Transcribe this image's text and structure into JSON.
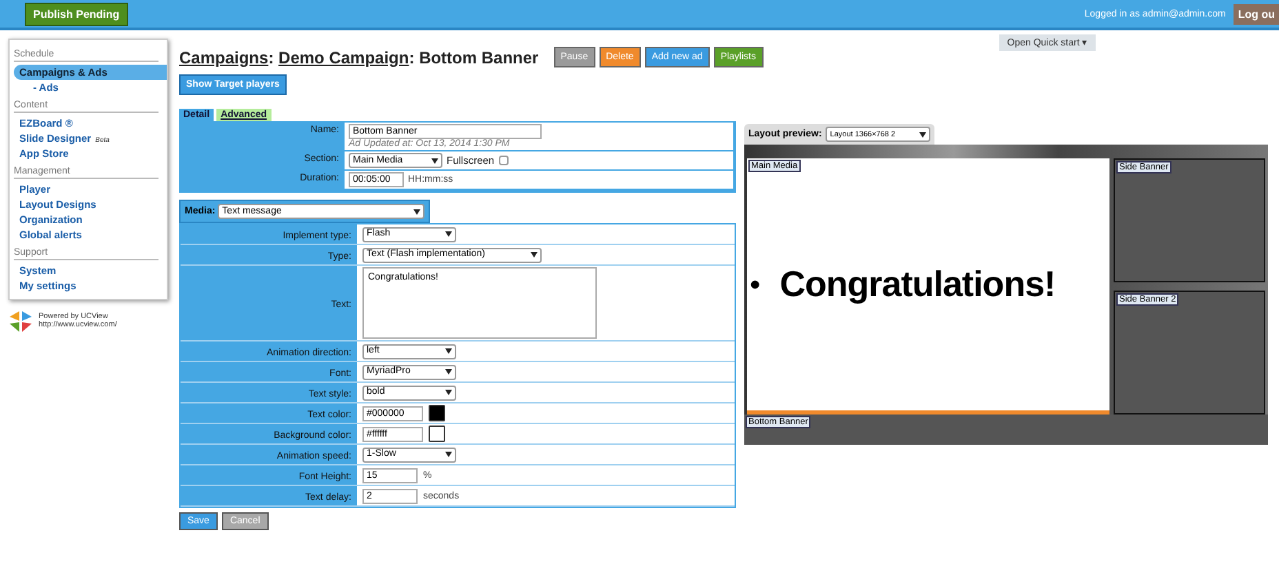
{
  "top_bar": {
    "publish_button": "Publish Pending",
    "logged_in": "Logged in as admin@admin.com",
    "logout_button": "Log ou"
  },
  "quick_start": "Open Quick start ▾",
  "sidebar": {
    "sections": [
      {
        "title": "Schedule",
        "items": [
          {
            "label": "Campaigns & Ads",
            "kind": "item",
            "selected": true
          },
          {
            "label": "- Ads",
            "kind": "sub",
            "selected": false
          }
        ]
      },
      {
        "title": "Content",
        "items": [
          {
            "label": "EZBoard ®",
            "kind": "item",
            "selected": false
          },
          {
            "label": "Slide Designer",
            "badge": "Beta",
            "kind": "item",
            "selected": false
          },
          {
            "label": "App Store",
            "kind": "item",
            "selected": false
          }
        ]
      },
      {
        "title": "Management",
        "items": [
          {
            "label": "Player",
            "kind": "item",
            "selected": false
          },
          {
            "label": "Layout Designs",
            "kind": "item",
            "selected": false
          },
          {
            "label": "Organization",
            "kind": "item",
            "selected": false
          },
          {
            "label": "Global alerts",
            "kind": "item",
            "selected": false
          }
        ]
      },
      {
        "title": "Support",
        "items": [
          {
            "label": "System",
            "kind": "item",
            "selected": false
          },
          {
            "label": "My settings",
            "kind": "item",
            "selected": false
          }
        ]
      }
    ],
    "powered_by": "Powered by UCView",
    "powered_url": "http://www.ucview.com/"
  },
  "title": {
    "links": [
      "Campaigns",
      "Demo Campaign"
    ],
    "separator": ":",
    "current": "Bottom Banner"
  },
  "actions": [
    {
      "label": "Pause",
      "color": "#9a9a9a"
    },
    {
      "label": "Delete",
      "color": "#f08a2c"
    },
    {
      "label": "Add new ad",
      "color": "#3a9be0"
    },
    {
      "label": "Playlists",
      "color": "#5aa028"
    }
  ],
  "show_target_button": "Show Target players",
  "tabs": [
    {
      "label": "Detail",
      "selected": true
    },
    {
      "label": "Advanced",
      "selected": false
    }
  ],
  "detail_rows": [
    {
      "label": "Name:",
      "kind": "text",
      "value": "Bottom Banner",
      "note": "Ad Updated at: Oct 13, 2014 1:30 PM"
    },
    {
      "label": "Section:",
      "kind": "select",
      "value": "Main Media",
      "check_label": "Fullscreen",
      "checked": false
    },
    {
      "label": "Duration:",
      "kind": "text",
      "value": "00:05:00",
      "hint": "HH:mm:ss"
    }
  ],
  "media": {
    "label": "Media:",
    "value": "Text message"
  },
  "media_rows": [
    {
      "label": "Implement type:",
      "kind": "select",
      "value": "Flash"
    },
    {
      "label": "Type:",
      "kind": "select",
      "value": "Text (Flash implementation)"
    },
    {
      "label": "Text:",
      "kind": "textarea",
      "value": "Congratulations!"
    },
    {
      "label": "Animation direction:",
      "kind": "select",
      "value": "left"
    },
    {
      "label": "Font:",
      "kind": "select",
      "value": "MyriadPro"
    },
    {
      "label": "Text style:",
      "kind": "select",
      "value": "bold"
    },
    {
      "label": "Text color:",
      "kind": "color",
      "value": "#000000",
      "color": "#000000"
    },
    {
      "label": "Background color:",
      "kind": "color",
      "value": "#ffffff",
      "color": "#ffffff"
    },
    {
      "label": "Animation speed:",
      "kind": "select",
      "value": "1-Slow"
    },
    {
      "label": "Font Height:",
      "kind": "text",
      "value": "15",
      "hint": "%"
    },
    {
      "label": "Text delay:",
      "kind": "text",
      "value": "2",
      "hint": "seconds"
    }
  ],
  "form_buttons": [
    {
      "label": "Save",
      "color": "#3a9be0"
    },
    {
      "label": "Cancel",
      "color": "#a8a8a8"
    }
  ],
  "preview": {
    "label": "Layout preview:",
    "layout": "Layout 1366×768 2",
    "main_label": "Main Media",
    "bullet": "•",
    "message": "Congratulations!",
    "side_labels": [
      "Side Banner",
      "Side Banner 2"
    ],
    "bottom_label": "Bottom Banner"
  }
}
